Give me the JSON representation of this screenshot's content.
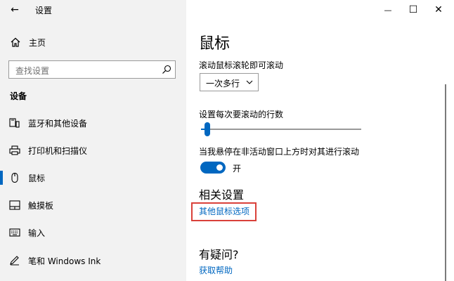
{
  "window": {
    "title": "设置",
    "back_glyph": "←",
    "minimize_glyph": "—",
    "maximize_glyph": "☐",
    "close_glyph": "✕"
  },
  "sidebar": {
    "home_label": "主页",
    "search_placeholder": "查找设置",
    "section_heading": "设备",
    "items": [
      {
        "label": "蓝牙和其他设备",
        "icon": "bluetooth-devices-icon",
        "selected": false
      },
      {
        "label": "打印机和扫描仪",
        "icon": "printer-icon",
        "selected": false
      },
      {
        "label": "鼠标",
        "icon": "mouse-icon",
        "selected": true
      },
      {
        "label": "触摸板",
        "icon": "touchpad-icon",
        "selected": false
      },
      {
        "label": "输入",
        "icon": "keyboard-icon",
        "selected": false
      },
      {
        "label": "笔和 Windows Ink",
        "icon": "pen-icon",
        "selected": false
      }
    ]
  },
  "main": {
    "page_title": "鼠标",
    "scroll_wheel_label": "滚动鼠标滚轮即可滚动",
    "scroll_wheel_value": "一次多行",
    "lines_label": "设置每次要滚动的行数",
    "lines_slider_fraction": 0.04,
    "inactive_scroll_label": "当我悬停在非活动窗口上方时对其进行滚动",
    "inactive_scroll_state": "开",
    "related_heading": "相关设置",
    "other_mouse_options_link": "其他鼠标选项",
    "question_heading": "有疑问?",
    "get_help_link": "获取帮助"
  },
  "colors": {
    "accent": "#0067c0",
    "highlight": "#d9413a",
    "sidebar_bg": "#f2f2f2"
  }
}
